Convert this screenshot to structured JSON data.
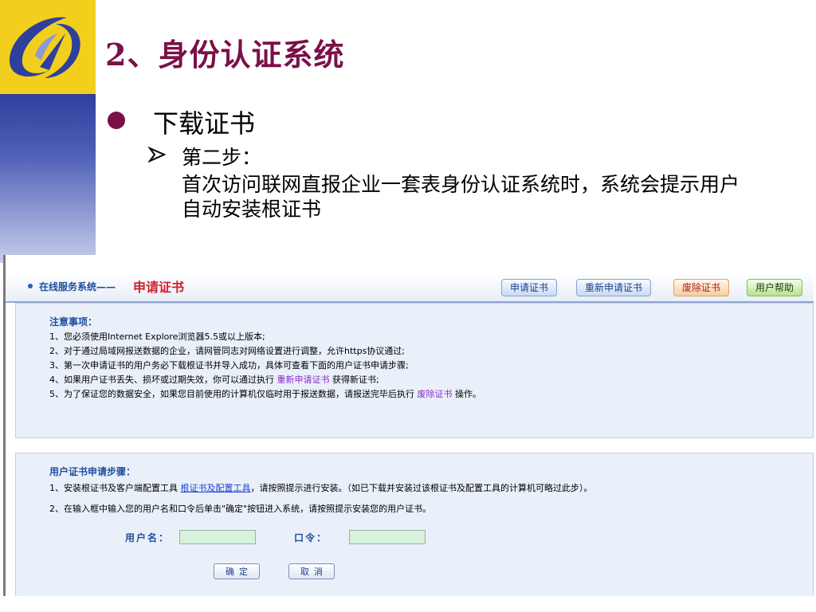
{
  "slide": {
    "title": "2、身份认证系统",
    "bullet": "下载证书",
    "step_title": "第二步：",
    "step_desc": "首次访问联网直报企业一套表身份认证系统时，系统会提示用户自动安装根证书"
  },
  "web": {
    "header": {
      "site_name": "在线服务系统——",
      "page_name": "申请证书",
      "buttons": [
        "申请证书",
        "重新申请证书",
        "废除证书",
        "用户帮助"
      ]
    },
    "notice": {
      "title": "注意事项：",
      "items": [
        "1、您必须使用Internet Explore浏览器5.5或以上版本;",
        "2、对于通过局域网报送数据的企业，请网管同志对网络设置进行调整，允许https协议通过;",
        "3、第一次申请证书的用户务必下载根证书并导入成功，具体可查看下面的用户证书申请步骤;"
      ],
      "item4_pre": "4、如果用户证书丢失、损坏或过期失效，你可以通过执行",
      "item4_link": "重新申请证书",
      "item4_post": "获得新证书;",
      "item5_pre": "5、为了保证您的数据安全，如果您目前使用的计算机仅临时用于报送数据，请报送完毕后执行",
      "item5_link": "废除证书",
      "item5_post": "操作。"
    },
    "steps": {
      "title": "用户证书申请步骤：",
      "step1_pre": "1、安装根证书及客户端配置工具",
      "step1_link": "根证书及配置工具",
      "step1_post": "，请按照提示进行安装。（如已下载并安装过该根证书及配置工具的计算机可略过此步）。",
      "step2": "2、在输入框中输入您的用户名和口令后单击\"确定\"按钮进入系统，请按照提示安装您的用户证书。",
      "username_label": "用户名：",
      "password_label": "口令：",
      "username_value": "",
      "password_value": "",
      "ok_label": "确定",
      "cancel_label": "取消"
    }
  },
  "colors": {
    "title": "#7b1048",
    "logo_bg": "#f2cf1c",
    "side_bar": "#2f3f9c",
    "header_red": "#d0202c",
    "link_purple": "#8a2bc7",
    "panel_bg": "#e9f0fa",
    "input_bg": "#d7f1dc"
  }
}
